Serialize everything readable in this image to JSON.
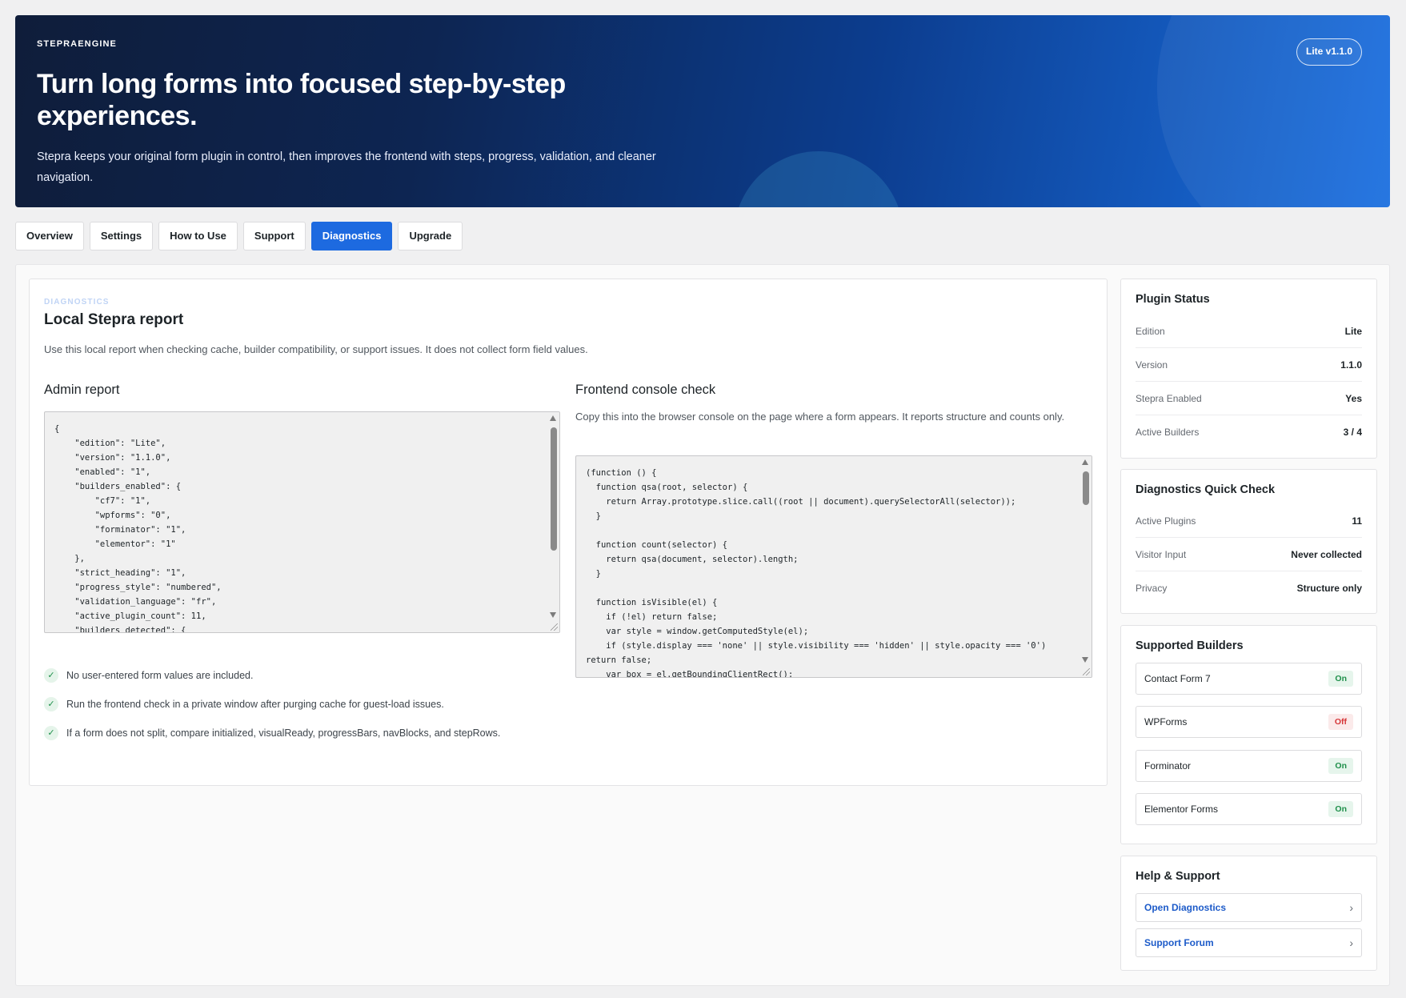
{
  "hero": {
    "eyebrow": "STEPRAENGINE",
    "title": "Turn long forms into focused step-by-step experiences.",
    "description": "Stepra keeps your original form plugin in control, then improves the frontend with steps, progress, validation, and cleaner navigation.",
    "version_badge": "Lite v1.1.0"
  },
  "tabs": [
    {
      "label": "Overview",
      "active": false
    },
    {
      "label": "Settings",
      "active": false
    },
    {
      "label": "How to Use",
      "active": false
    },
    {
      "label": "Support",
      "active": false
    },
    {
      "label": "Diagnostics",
      "active": true
    },
    {
      "label": "Upgrade",
      "active": false
    }
  ],
  "main": {
    "eyebrow": "DIAGNOSTICS",
    "title": "Local Stepra report",
    "description": "Use this local report when checking cache, builder compatibility, or support issues. It does not collect form field values.",
    "admin_report": {
      "heading": "Admin report",
      "code": "{\n    \"edition\": \"Lite\",\n    \"version\": \"1.1.0\",\n    \"enabled\": \"1\",\n    \"builders_enabled\": {\n        \"cf7\": \"1\",\n        \"wpforms\": \"0\",\n        \"forminator\": \"1\",\n        \"elementor\": \"1\"\n    },\n    \"strict_heading\": \"1\",\n    \"progress_style\": \"numbered\",\n    \"validation_language\": \"fr\",\n    \"active_plugin_count\": 11,\n    \"builders_detected\": {"
    },
    "console_check": {
      "heading": "Frontend console check",
      "description": "Copy this into the browser console on the page where a form appears. It reports structure and counts only.",
      "code": "(function () {\n  function qsa(root, selector) {\n    return Array.prototype.slice.call((root || document).querySelectorAll(selector));\n  }\n\n  function count(selector) {\n    return qsa(document, selector).length;\n  }\n\n  function isVisible(el) {\n    if (!el) return false;\n    var style = window.getComputedStyle(el);\n    if (style.display === 'none' || style.visibility === 'hidden' || style.opacity === '0')\nreturn false;\n    var box = el.getBoundingClientRect();"
    },
    "checks": [
      "No user-entered form values are included.",
      "Run the frontend check in a private window after purging cache for guest-load issues.",
      "If a form does not split, compare initialized, visualReady, progressBars, navBlocks, and stepRows."
    ]
  },
  "sidebar": {
    "plugin_status": {
      "title": "Plugin Status",
      "rows": [
        {
          "label": "Edition",
          "value": "Lite"
        },
        {
          "label": "Version",
          "value": "1.1.0"
        },
        {
          "label": "Stepra Enabled",
          "value": "Yes"
        },
        {
          "label": "Active Builders",
          "value": "3 / 4"
        }
      ]
    },
    "quick_check": {
      "title": "Diagnostics Quick Check",
      "rows": [
        {
          "label": "Active Plugins",
          "value": "11"
        },
        {
          "label": "Visitor Input",
          "value": "Never collected"
        },
        {
          "label": "Privacy",
          "value": "Structure only"
        }
      ]
    },
    "builders": {
      "title": "Supported Builders",
      "items": [
        {
          "name": "Contact Form 7",
          "status": "On"
        },
        {
          "name": "WPForms",
          "status": "Off"
        },
        {
          "name": "Forminator",
          "status": "On"
        },
        {
          "name": "Elementor Forms",
          "status": "On"
        }
      ]
    },
    "help": {
      "title": "Help & Support",
      "links": [
        {
          "label": "Open Diagnostics",
          "icon": "chevron-right-icon"
        },
        {
          "label": "Support Forum",
          "icon": "chevron-right-icon"
        }
      ]
    }
  },
  "colors": {
    "accent": "#1d6ae0",
    "on": "#1e8f4a",
    "off": "#d63638"
  }
}
